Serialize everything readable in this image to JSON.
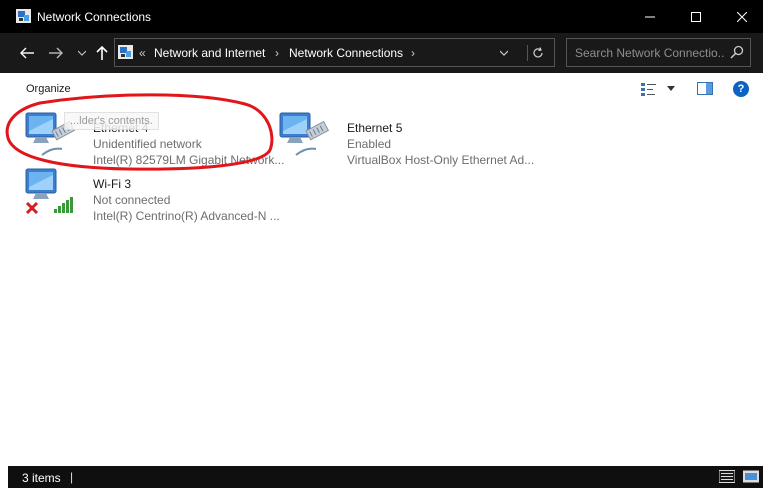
{
  "window": {
    "title": "Network Connections",
    "minimize_icon": "minimize-icon",
    "maximize_icon": "maximize-icon",
    "close_icon": "close-icon"
  },
  "nav": {
    "back_icon": "arrow-left-icon",
    "forward_icon": "arrow-right-icon",
    "recent_icon": "chevron-down-icon",
    "up_icon": "arrow-up-icon",
    "address": {
      "overflow": "«",
      "crumbs": [
        "Network and Internet",
        "Network Connections"
      ],
      "separator": "›"
    },
    "search": {
      "placeholder": "Search Network Connectio..."
    }
  },
  "command_bar": {
    "organize_label": "Organize",
    "view_icon": "details-view-icon",
    "preview_icon": "preview-pane-icon",
    "help_label": "?"
  },
  "items": [
    {
      "name": "Ethernet 4",
      "status": "Unidentified network",
      "device": "Intel(R) 82579LM Gigabit Network...",
      "icon": "ethernet-adapter-icon"
    },
    {
      "name": "Ethernet 5",
      "status": "Enabled",
      "device": "VirtualBox Host-Only Ethernet Ad...",
      "icon": "ethernet-adapter-icon"
    },
    {
      "name": "Wi-Fi 3",
      "status": "Not connected",
      "device": "Intel(R) Centrino(R) Advanced-N ...",
      "icon": "wifi-adapter-icon"
    }
  ],
  "tooltip": "...lder's contents.",
  "status_bar": {
    "item_count": "3 items",
    "separator": "|"
  },
  "colors": {
    "titlebar": "#000000",
    "navbar": "#191919",
    "annotation_circle": "#e0161b",
    "help_blue": "#0b63c4"
  }
}
